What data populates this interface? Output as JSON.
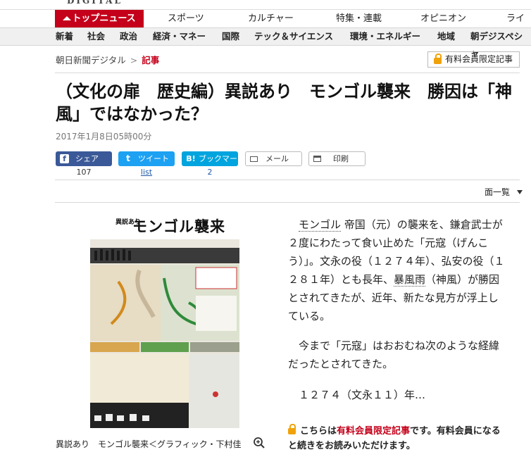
{
  "header": {
    "brand": "DIGITAL",
    "tabs": [
      "トップニュース",
      "スポーツ",
      "カルチャー",
      "特集・連載",
      "オピニオン",
      "ライ"
    ],
    "subnav": [
      "新着",
      "社会",
      "政治",
      "経済・マネー",
      "国際",
      "テック＆サイエンス",
      "環境・エネルギー",
      "地域",
      "朝デジスペシャ"
    ]
  },
  "breadcrumb": {
    "home": "朝日新聞デジタル",
    "sep": ">",
    "current": "記事"
  },
  "paid_badge": "有料会員限定記事",
  "article": {
    "title": "（文化の扉　歴史編）異説あり　モンゴル襲来　勝因は「神風」ではなかった？",
    "date": "2017年1月8日05時00分"
  },
  "share": {
    "facebook": {
      "label": "シェア",
      "count": "107",
      "icon": "f"
    },
    "twitter": {
      "label": "ツイート",
      "count": "list",
      "icon": "t"
    },
    "hatena": {
      "label": "ブックマーク",
      "count": "2",
      "icon": "B!"
    },
    "mail": "メール",
    "print": "印刷"
  },
  "page_menu": "面一覧",
  "figure": {
    "kicker": "異説あり",
    "title": "モンゴル襲来",
    "caption": "異説あり　モンゴル襲来＜グラフィック・下村佳"
  },
  "body": {
    "p1_link1": "モンゴル",
    "p1_a": "帝国（元）の襲来を、鎌倉武士が２度にわたって食い止めた「元寇（げんこう）」。文永の役（１２７４年）、弘安の役（１２８１年）とも長年、",
    "p1_link2": "暴風雨",
    "p1_b": "（神風）が勝因とされてきたが、近年、新たな見方が浮上している。",
    "p2": "今まで「元寇」はおおむね次のような経緯だったとされてきた。",
    "p3": "１２７４（文永１１）年…"
  },
  "notice": {
    "pre": "こちらは",
    "link": "有料会員限定記事",
    "post": "です。有料会員になると続きをお読みいただけます。"
  },
  "colors": {
    "accent": "#c4001a",
    "facebook": "#3b5998",
    "twitter": "#1da1f2",
    "hatena": "#00a4de",
    "lock": "#f0a20a"
  }
}
